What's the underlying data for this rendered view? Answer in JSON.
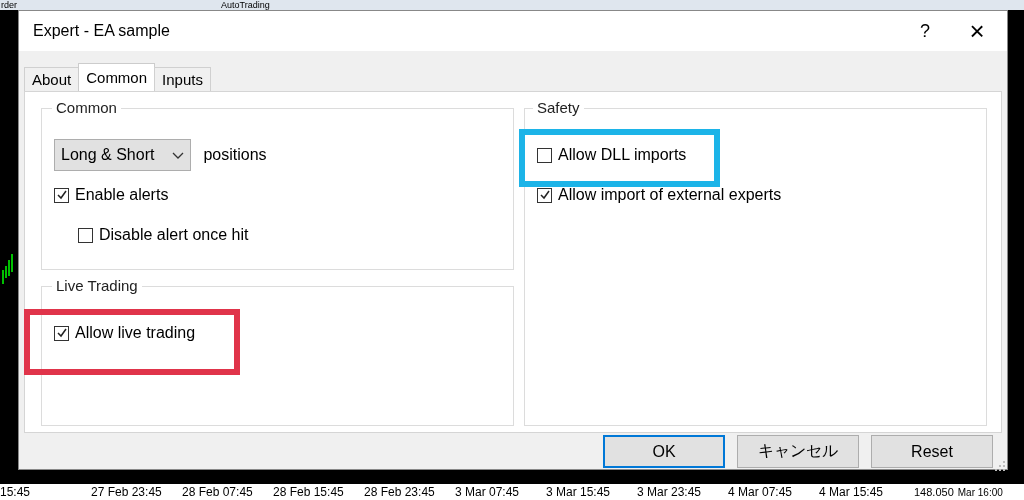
{
  "background": {
    "toolbar": {
      "left_text": "rder",
      "button": "AutoTrading"
    },
    "price": "148.050",
    "time_axis": [
      "15:45",
      "27 Feb 23:45",
      "28 Feb 07:45",
      "28 Feb 15:45",
      "28 Feb 23:45",
      "3 Mar 07:45",
      "3 Mar 15:45",
      "3 Mar 23:45",
      "4 Mar 07:45",
      "4 Mar 15:45"
    ],
    "right_time": "Mar 16:00"
  },
  "dialog": {
    "title": "Expert - EA sample",
    "help": "?",
    "close": "×",
    "tabs": [
      {
        "label": "About",
        "selected": false
      },
      {
        "label": "Common",
        "selected": true
      },
      {
        "label": "Inputs",
        "selected": false
      }
    ],
    "columns": [
      {
        "groups": [
          {
            "title": "Common",
            "items": [
              {
                "kind": "dropdown",
                "value": "Long & Short",
                "suffix": "positions"
              },
              {
                "kind": "checkbox",
                "label": "Enable alerts",
                "checked": true,
                "indented": false
              },
              {
                "kind": "checkbox",
                "label": "Disable alert once hit",
                "checked": false,
                "indented": true
              }
            ]
          },
          {
            "title": "Live Trading",
            "items": [
              {
                "kind": "checkbox",
                "label": "Allow live trading",
                "checked": true,
                "indented": false,
                "highlight": {
                  "color": "#e0344a"
                }
              }
            ]
          }
        ]
      },
      {
        "groups": [
          {
            "title": "Safety",
            "items": [
              {
                "kind": "checkbox",
                "label": "Allow DLL imports",
                "checked": false,
                "indented": false,
                "highlight": {
                  "color": "#1cb4e8"
                }
              },
              {
                "kind": "checkbox",
                "label": "Allow import of external experts",
                "checked": true,
                "indented": false
              }
            ]
          }
        ]
      }
    ],
    "buttons": [
      {
        "label": "OK",
        "default": true
      },
      {
        "label": "キャンセル",
        "default": false
      },
      {
        "label": "Reset",
        "default": false
      }
    ]
  }
}
